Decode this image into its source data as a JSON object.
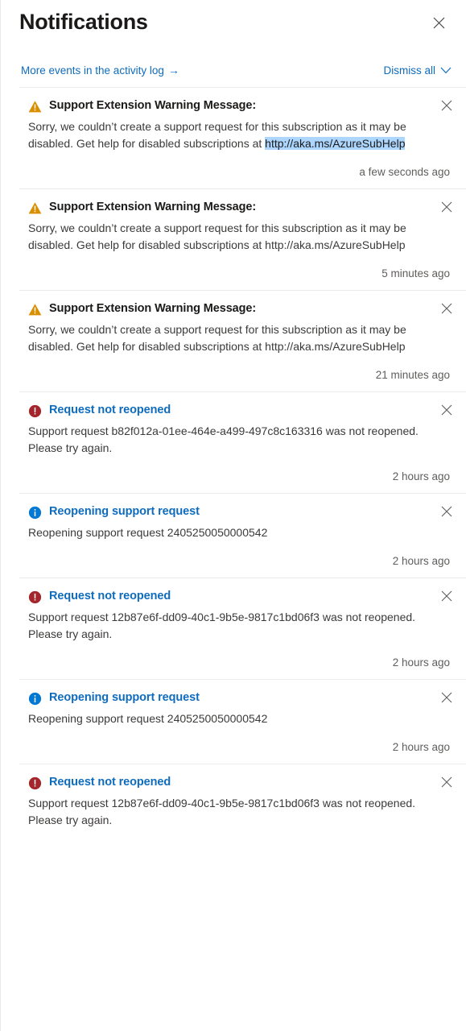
{
  "panel": {
    "title": "Notifications",
    "close_icon": "close-icon"
  },
  "action_bar": {
    "activity_log_label": "More events in the activity log",
    "activity_log_arrow": "→",
    "dismiss_all_label": "Dismiss all",
    "chevron_icon": "chevron-down-icon"
  },
  "colors": {
    "link": "#0f6cbd",
    "warning": "#d98f00",
    "error": "#a4262c",
    "info": "#0078d4",
    "selection": "#add6ff",
    "divider": "#edebe9",
    "body_text": "#3b3a39",
    "time_text": "#605e5c"
  },
  "notifications": [
    {
      "severity": "warning",
      "icon": "warning-triangle-icon",
      "title": "Support Extension Warning Message:",
      "body_before": "Sorry, we couldn’t create a support request for this subscription as it may be disabled. Get help for disabled subscriptions at ",
      "body_highlight": "http://aka.ms/AzureSubHelp",
      "time": "a few seconds ago",
      "truncated": false
    },
    {
      "severity": "warning",
      "icon": "warning-triangle-icon",
      "title": "Support Extension Warning Message:",
      "body_before": "Sorry, we couldn’t create a support request for this subscription as it may be disabled. Get help for disabled subscriptions at http://aka.ms/AzureSubHelp",
      "body_highlight": "",
      "time": "5 minutes ago",
      "truncated": false
    },
    {
      "severity": "warning",
      "icon": "warning-triangle-icon",
      "title": "Support Extension Warning Message:",
      "body_before": "Sorry, we couldn’t create a support request for this subscription as it may be disabled. Get help for disabled subscriptions at http://aka.ms/AzureSubHelp",
      "body_highlight": "",
      "time": "21 minutes ago",
      "truncated": false
    },
    {
      "severity": "error",
      "icon": "error-circle-icon",
      "title": "Request not reopened",
      "body_before": "Support request b82f012a-01ee-464e-a499-497c8c163316 was not reopened. Please try again.",
      "body_highlight": "",
      "time": "2 hours ago",
      "truncated": false
    },
    {
      "severity": "info",
      "icon": "info-circle-icon",
      "title": "Reopening support request",
      "body_before": "Reopening support request 2405250050000542",
      "body_highlight": "",
      "time": "2 hours ago",
      "truncated": false
    },
    {
      "severity": "error",
      "icon": "error-circle-icon",
      "title": "Request not reopened",
      "body_before": "Support request 12b87e6f-dd09-40c1-9b5e-9817c1bd06f3 was not reopened. Please try again.",
      "body_highlight": "",
      "time": "2 hours ago",
      "truncated": false
    },
    {
      "severity": "info",
      "icon": "info-circle-icon",
      "title": "Reopening support request",
      "body_before": "Reopening support request 2405250050000542",
      "body_highlight": "",
      "time": "2 hours ago",
      "truncated": false
    },
    {
      "severity": "error",
      "icon": "error-circle-icon",
      "title": "Request not reopened",
      "body_before": "Support request 12b87e6f-dd09-40c1-9b5e-9817c1bd06f3 was not reopened. Please try again.",
      "body_highlight": "",
      "time": "",
      "truncated": true
    }
  ]
}
